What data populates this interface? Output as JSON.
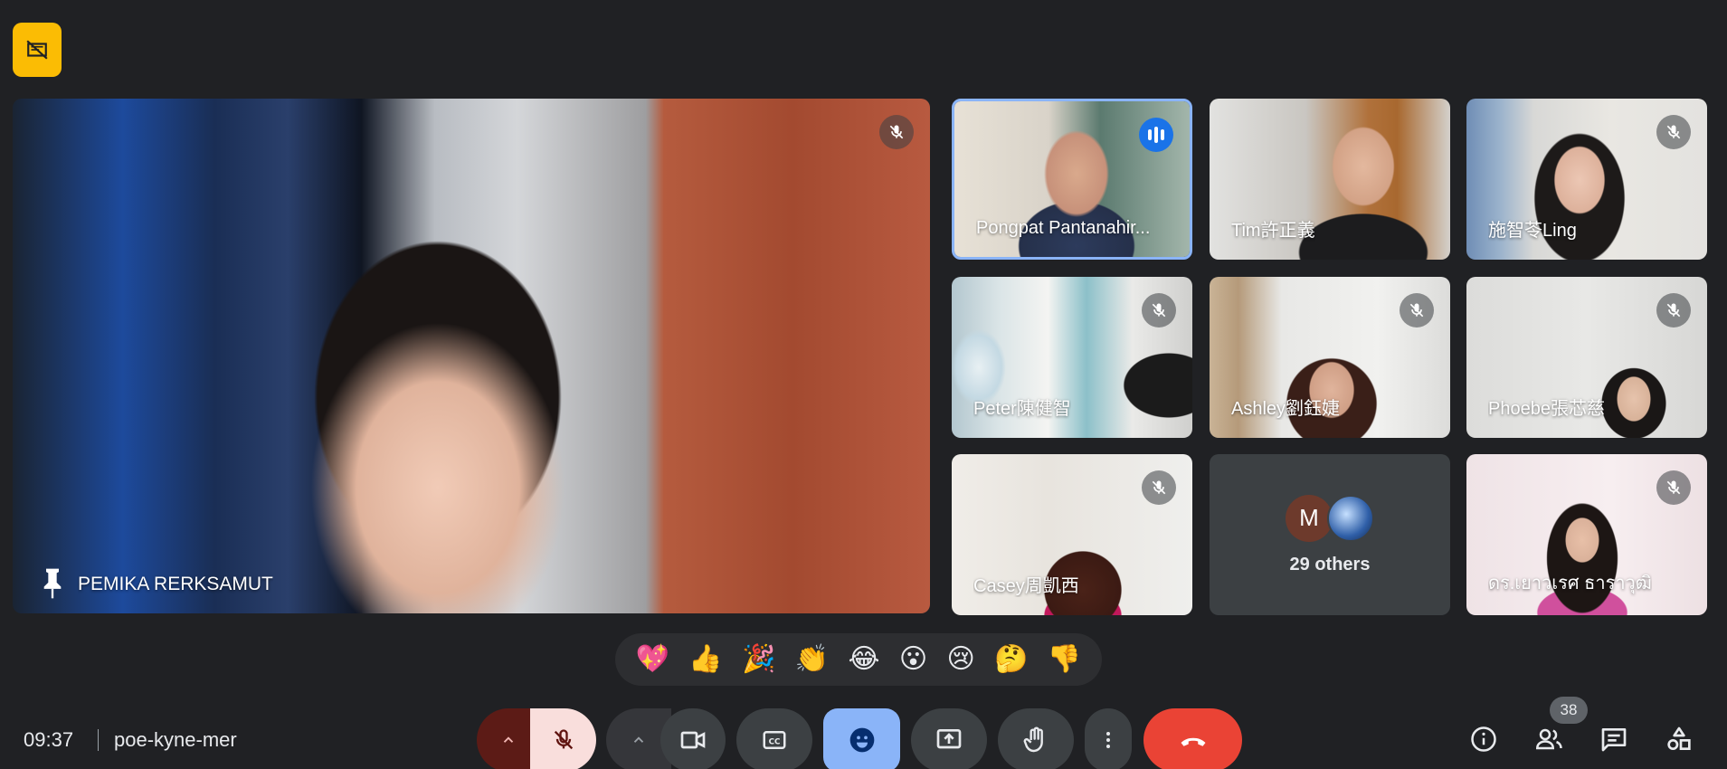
{
  "main_tile": {
    "name": "PEMIKA RERKSAMUT"
  },
  "grid": [
    {
      "name": "Pongpat Pantanahir...",
      "status": "speaking",
      "active": true
    },
    {
      "name": "Tim許正義",
      "status": "none"
    },
    {
      "name": "施智苓Ling",
      "status": "muted"
    },
    {
      "name": "Peter陳健智",
      "status": "muted"
    },
    {
      "name": "Ashley劉鈺婕",
      "status": "muted"
    },
    {
      "name": "Phoebe張芯慈",
      "status": "muted"
    },
    {
      "name": "Casey周凱西",
      "status": "muted"
    },
    {
      "name": "ดร.เยาวเรศ ธาราวุฒิ",
      "status": "muted"
    }
  ],
  "others": {
    "avatar_letter": "M",
    "label": "29 others"
  },
  "reactions": [
    "💖",
    "👍",
    "🎉",
    "👏",
    "😂",
    "😮",
    "😢",
    "🤔",
    "👎"
  ],
  "meeting": {
    "time": "09:37",
    "code": "poe-kyne-mer"
  },
  "participants_count": "38",
  "icons": {
    "recording": "no-video-icon",
    "mic": "mic-off-icon",
    "camera": "camera-icon",
    "captions": "closed-captions-icon",
    "emoji": "emoji-icon",
    "present": "present-screen-icon",
    "hand": "raise-hand-icon",
    "more": "more-vertical-icon",
    "hangup": "hang-up-icon",
    "info": "info-icon",
    "people": "people-icon",
    "chat": "chat-icon",
    "activities": "activities-icon"
  },
  "colors": {
    "background": "#202124",
    "active_border": "#8ab4f8",
    "hangup": "#ea4335",
    "rec_badge": "#fbbc04"
  }
}
